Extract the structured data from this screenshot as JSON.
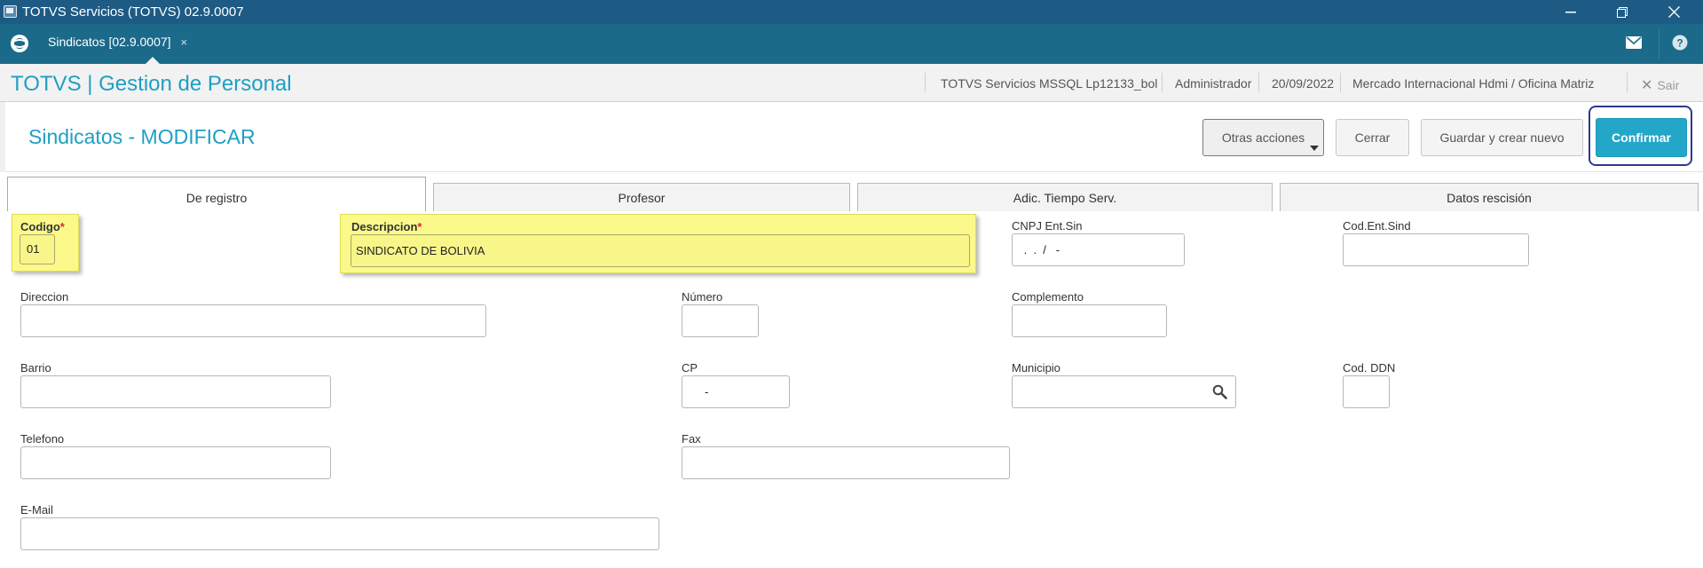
{
  "window": {
    "title": "TOTVS Servicios (TOTVS) 02.9.0007"
  },
  "tabbar": {
    "doc_tab_label": "Sindicatos [02.9.0007]",
    "doc_tab_close": "×"
  },
  "module_header": {
    "title": "TOTVS | Gestion de Personal",
    "environment": "TOTVS Servicios MSSQL Lp12133_bol",
    "user": "Administrador",
    "date": "20/09/2022",
    "company": "Mercado Internacional Hdmi / Oficina Matriz",
    "exit_label": "Sair"
  },
  "page": {
    "title": "Sindicatos - MODIFICAR",
    "buttons": {
      "other_actions": "Otras acciones",
      "close": "Cerrar",
      "save_new": "Guardar y crear nuevo",
      "confirm": "Confirmar"
    }
  },
  "tabs": [
    {
      "label": "De registro",
      "active": true
    },
    {
      "label": "Profesor",
      "active": false
    },
    {
      "label": "Adic. Tiempo Serv.",
      "active": false
    },
    {
      "label": "Datos rescisión",
      "active": false
    }
  ],
  "fields": {
    "codigo": {
      "label": "Codigo",
      "required_mark": "*",
      "value": "01"
    },
    "descripcion": {
      "label": "Descripcion",
      "required_mark": "*",
      "value": "SINDICATO DE BOLIVIA"
    },
    "cnpj": {
      "label": "CNPJ Ent.Sin",
      "value": " .  .  /   -"
    },
    "cod_ent_sind": {
      "label": "Cod.Ent.Sind",
      "value": ""
    },
    "direccion": {
      "label": "Direccion",
      "value": ""
    },
    "numero": {
      "label": "Número",
      "value": ""
    },
    "complemento": {
      "label": "Complemento",
      "value": ""
    },
    "barrio": {
      "label": "Barrio",
      "value": ""
    },
    "cp": {
      "label": "CP",
      "value": "-"
    },
    "municipio": {
      "label": "Municipio",
      "value": ""
    },
    "cod_ddn": {
      "label": "Cod. DDN",
      "value": ""
    },
    "telefono": {
      "label": "Telefono",
      "value": ""
    },
    "fax": {
      "label": "Fax",
      "value": ""
    },
    "email": {
      "label": "E-Mail",
      "value": ""
    }
  },
  "colors": {
    "titlebar": "#1d5b85",
    "tabbar": "#1b6a8a",
    "accent": "#1e9fc4",
    "confirm_button": "#23a7c9",
    "highlight": "#fbf98a"
  }
}
